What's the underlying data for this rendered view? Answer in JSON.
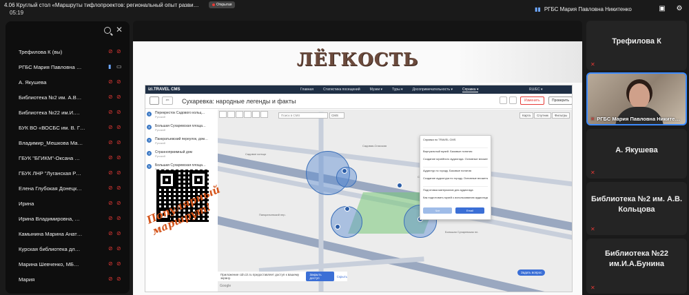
{
  "meeting": {
    "title": "4.06 Круглый стол «Маршруты тифлопроектов: региональный опыт разви…",
    "badge": "Открытая",
    "timer": "05:19",
    "host_name": "РГБС Мария Павловна Никитенко"
  },
  "participants": [
    {
      "name": "Трефилова К (вы)",
      "mic": "off",
      "cam": "off"
    },
    {
      "name": "РГБС Мария Павловна …",
      "mic": "on",
      "cam": "on"
    },
    {
      "name": "А. Якушева",
      "mic": "off",
      "cam": "off"
    },
    {
      "name": "Библиотека №2 им. А.В…",
      "mic": "off",
      "cam": "off"
    },
    {
      "name": "Библиотека №22 им.И.…",
      "mic": "off",
      "cam": "off"
    },
    {
      "name": "БУК ВО «ВОСБС им. В. Г…",
      "mic": "off",
      "cam": "off"
    },
    {
      "name": "Владимир_Мешкова Ма…",
      "mic": "off",
      "cam": "off"
    },
    {
      "name": "ГБУК \"БГИКМ\"-Оксана …",
      "mic": "off",
      "cam": "off"
    },
    {
      "name": "ГБУК ЛНР \"Луганская Р…",
      "mic": "off",
      "cam": "off"
    },
    {
      "name": "Елена Глубокая Донецк…",
      "mic": "off",
      "cam": "off"
    },
    {
      "name": "Ирина",
      "mic": "off",
      "cam": "off"
    },
    {
      "name": "Ирина Владимировна, …",
      "mic": "off",
      "cam": "off"
    },
    {
      "name": "Камынина Марина Анат…",
      "mic": "off",
      "cam": "off"
    },
    {
      "name": "Курская библиотека дл…",
      "mic": "off",
      "cam": "off"
    },
    {
      "name": "Марина Шевченко, МБ…",
      "mic": "off",
      "cam": "off"
    },
    {
      "name": "Мария",
      "mic": "off",
      "cam": "off"
    }
  ],
  "slide": {
    "heading": "ЛЁГКОСТЬ",
    "handwritten": "Популярный маршрут!",
    "cms": {
      "logo": "izi.TRAVEL CMS",
      "menu": [
        "Главная",
        "Статистика посещений",
        "Музеи ▾",
        "Туры ▾",
        "Досопримечательность ▾",
        "Справка ▾"
      ],
      "lang": "RU/EC ▾",
      "page_title": "Сухаревка: народные легенды и факты",
      "cancel_label": "Изменить",
      "check_label": "Проверить",
      "route_items": [
        {
          "num": "1",
          "name": "Перекресток Садового кольц…",
          "sub": "Русский"
        },
        {
          "num": "2",
          "name": "Большая Сухаревская площа…",
          "sub": "Русский"
        },
        {
          "num": "3",
          "name": "Панкратьевский переулок, дом…",
          "sub": "Русский"
        },
        {
          "num": "4",
          "name": "Странноприимный дом",
          "sub": "Русский"
        },
        {
          "num": "5",
          "name": "Большая Сухаревская площа…",
          "sub": "Русский"
        }
      ],
      "map_search_placeholder": "Поиск в CMS",
      "map_select": "CMS",
      "map_types": [
        "Карта",
        "Спутник",
        "Фильтры"
      ],
      "map_labels": [
        "Садовая-Спасская",
        "Сухаревская площадь",
        "Садовое кольцо",
        "Панкратьевский пер.",
        "Большая Сухаревская пл."
      ],
      "cookie_text": "Приложение cdn.izi.ru предоставляет доступ к вашему экрану.",
      "cookie_btn": "Закрыть доступ",
      "cookie_hide": "Скрыть",
      "ask_btn": "Задать вопрос",
      "google": "Google",
      "dropdown": {
        "items": [
          "Справка по TRAVEL CMS",
          "Виртуальный музей. Базовые понятия",
          "Создание музейного аудиогида. Основные вложения",
          "Аудиотур по городу. Базовые понятия",
          "Создание аудиотура по городу. Основные вложения",
          "Подготовка материалов для аудиогида",
          "Как подготовить музей к использованию аудиогида"
        ],
        "btn1": "Чат",
        "btn2": "Email"
      }
    }
  },
  "tiles": [
    {
      "name": "Трефилова К"
    },
    {
      "name": "РГБС Мария Павловна Никите…"
    },
    {
      "name": "А. Якушева"
    },
    {
      "name": "Библиотека №2 им. А.В. Кольцова"
    },
    {
      "name": "Библиотека №22 им.И.А.Бунина"
    }
  ],
  "colors": {
    "accent": "#3d8bfd",
    "muted_red": "#e53935",
    "bg": "#1a1a1a"
  }
}
